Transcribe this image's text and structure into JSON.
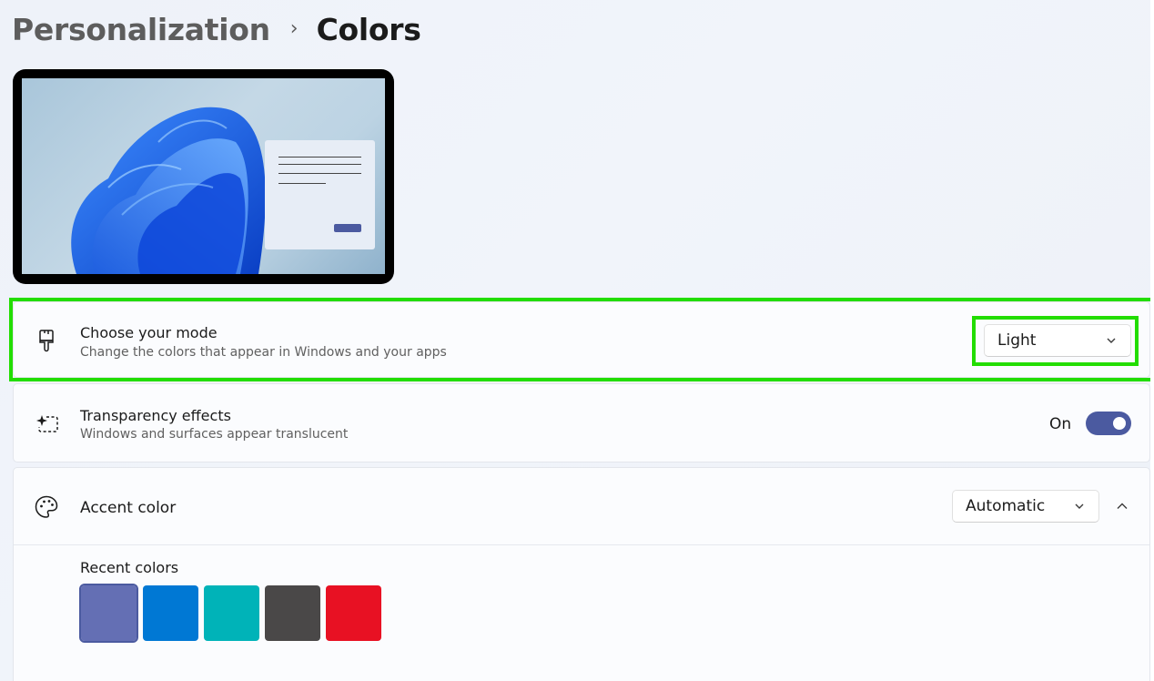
{
  "breadcrumb": {
    "parent": "Personalization",
    "separator": "›",
    "current": "Colors"
  },
  "mode": {
    "title": "Choose your mode",
    "subtitle": "Change the colors that appear in Windows and your apps",
    "icon": "paintbrush-icon",
    "selected": "Light"
  },
  "transparency": {
    "title": "Transparency effects",
    "subtitle": "Windows and surfaces appear translucent",
    "icon": "transparency-icon",
    "state_label": "On",
    "enabled": true
  },
  "accent": {
    "title": "Accent color",
    "icon": "palette-icon",
    "selected": "Automatic",
    "expanded": true,
    "recent_label": "Recent colors",
    "recent_colors": [
      "#646fb4",
      "#0078d4",
      "#00b3b8",
      "#4a4848",
      "#e81123"
    ]
  },
  "colors": {
    "accent": "#4b5aa0",
    "highlight": "#22dd00"
  }
}
